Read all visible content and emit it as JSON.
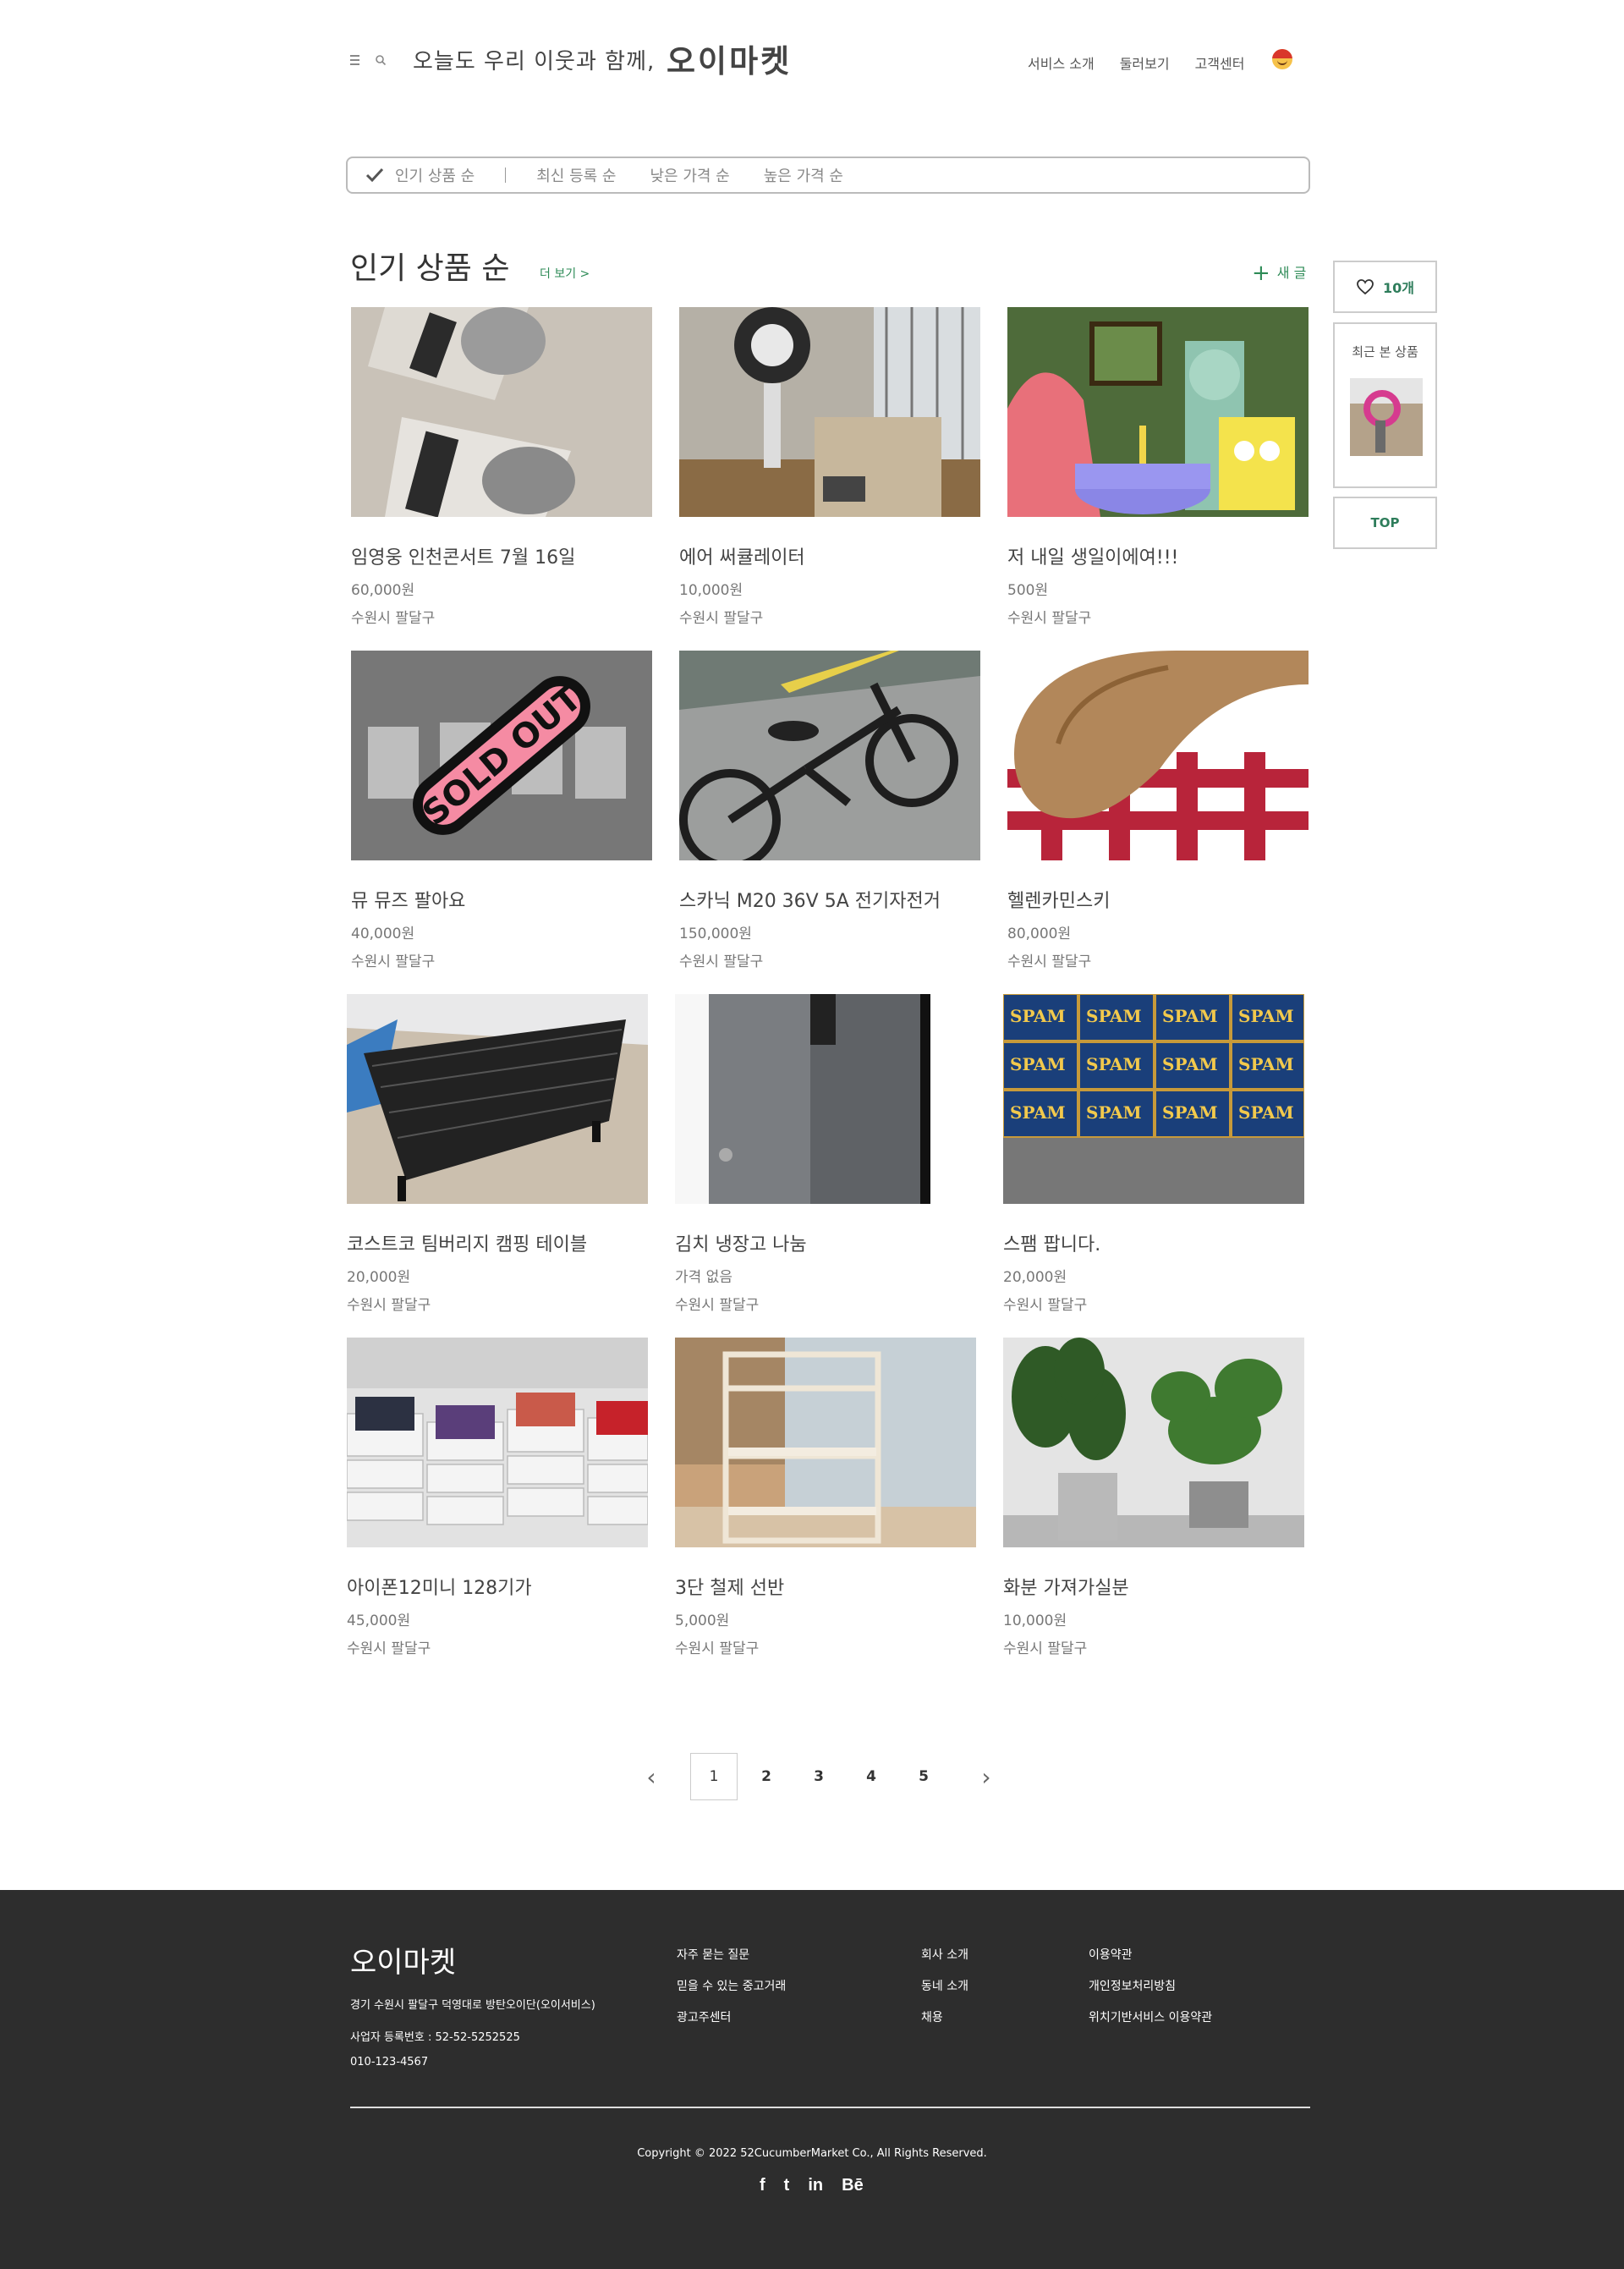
{
  "header": {
    "tagline": "오늘도 우리 이웃과 함께,",
    "brand": "오이마켓",
    "nav": [
      "서비스 소개",
      "둘러보기",
      "고객센터"
    ]
  },
  "sort": {
    "items": [
      "인기 상품 순",
      "최신 등록 순",
      "낮은 가격 순",
      "높은 가격 순"
    ],
    "selected": "인기 상품 순"
  },
  "section": {
    "title": "인기 상품 순",
    "more": "더 보기 >",
    "new_post": "새 글",
    "new_post_icon": "plus-icon"
  },
  "products": [
    {
      "title": "임영웅 인천콘서트 7월 16일",
      "price": "60,000원",
      "location": "수원시 팔달구",
      "image": "concert-ticket-photo"
    },
    {
      "title": "에어 써큘레이터",
      "price": "10,000원",
      "location": "수원시 팔달구",
      "image": "air-circulator-photo"
    },
    {
      "title": "저 내일 생일이에여!!!",
      "price": "500원",
      "location": "수원시 팔달구",
      "image": "birthday-cartoon-photo"
    },
    {
      "title": "뮤 뮤즈 팔아요",
      "price": "40,000원",
      "location": "수원시 팔달구",
      "image": "mew-cards-photo",
      "sold_out": "SOLD OUT"
    },
    {
      "title": "스카닉 M20  36V 5A 전기자전거",
      "price": "150,000원",
      "location": "수원시 팔달구",
      "image": "electric-bike-photo"
    },
    {
      "title": "헬렌카민스키",
      "price": "80,000원",
      "location": "수원시 팔달구",
      "image": "straw-hat-photo"
    },
    {
      "title": "코스트코 팀버리지 캠핑 테이블",
      "price": "20,000원",
      "location": "수원시 팔달구",
      "image": "camping-table-photo"
    },
    {
      "title": "김치 냉장고 나눔",
      "price": "가격 없음",
      "location": "수원시 팔달구",
      "image": "kimchi-fridge-photo"
    },
    {
      "title": "스팸 팝니다.",
      "price": "20,000원",
      "location": "수원시 팔달구",
      "image": "spam-cans-photo",
      "can_label": "SPAM"
    },
    {
      "title": "아이폰12미니 128기가",
      "price": "45,000원",
      "location": "수원시 팔달구",
      "image": "iphone-boxes-photo"
    },
    {
      "title": "3단 철제 선반",
      "price": "5,000원",
      "location": "수원시 팔달구",
      "image": "metal-shelf-photo"
    },
    {
      "title": "화분 가져가실분",
      "price": "10,000원",
      "location": "수원시 팔달구",
      "image": "plants-photo"
    }
  ],
  "side": {
    "likes": "10개",
    "recent_label": "최근 본 상품",
    "top": "TOP"
  },
  "pagination": {
    "pages": [
      "1",
      "2",
      "3",
      "4",
      "5"
    ],
    "current": "1",
    "prev": "‹",
    "next": "›"
  },
  "footer": {
    "brand": "오이마켓",
    "address": "경기 수원시 팔달구 덕영대로 방탄오이단(오이서비스)",
    "biz": "사업자 등록번호 : 52-52-5252525",
    "tel": "010-123-4567",
    "col1": [
      "자주 묻는 질문",
      "믿을 수 있는 중고거래",
      "광고주센터"
    ],
    "col2": [
      "회사 소개",
      "동네 소개",
      "채용"
    ],
    "col3": [
      "이용약관",
      "개인정보처리방침",
      "위치기반서비스 이용약관"
    ],
    "copyright": "Copyright © 2022 52CucumberMarket Co., All Rights Reserved.",
    "social": [
      "f",
      "t",
      "in",
      "Bē"
    ]
  },
  "colors": {
    "accent": "#2e8b57",
    "footer_bg": "#2d2d2d"
  }
}
